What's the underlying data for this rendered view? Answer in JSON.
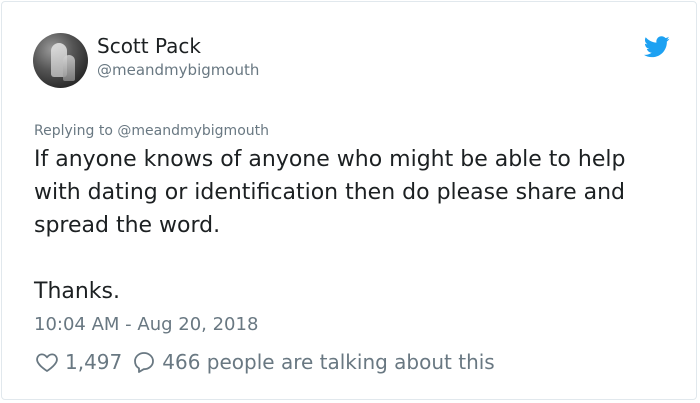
{
  "author": {
    "name": "Scott Pack",
    "handle": "@meandmybigmouth"
  },
  "reply": {
    "text": "Replying to @meandmybigmouth"
  },
  "tweet": {
    "line1": "If anyone knows of anyone who might be able to help with dating or identification then do please share and spread the word.",
    "line2": "Thanks."
  },
  "meta": {
    "timestamp": "10:04 AM - Aug 20, 2018"
  },
  "engagement": {
    "likes": "1,497",
    "talking": "466 people are talking about this"
  },
  "colors": {
    "twitter_blue": "#1da1f2",
    "text": "#1c2022",
    "secondary": "#697882",
    "border": "#e1e8ed"
  },
  "icons": {
    "bird": "twitter-bird-icon",
    "like": "heart-icon",
    "reply": "speech-bubble-icon"
  }
}
